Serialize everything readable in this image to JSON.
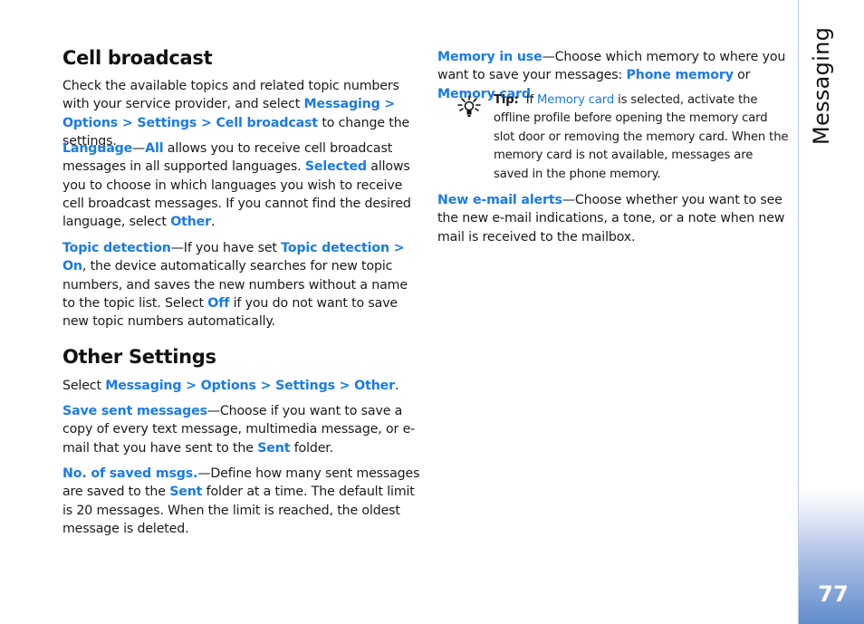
{
  "sidebar": {
    "section_label": "Messaging",
    "page_number": "77"
  },
  "left": {
    "cell_broadcast": {
      "heading": "Cell broadcast",
      "intro": {
        "t1": "Check the available topics and related topic numbers with your service provider, and select ",
        "path": "Messaging > Options > Settings > Cell broadcast",
        "t2": " to change the settings."
      },
      "language": {
        "label": "Language",
        "dash": "—",
        "all": "All",
        "t1": " allows you to receive cell broadcast messages in all supported languages. ",
        "selected": "Selected",
        "t2": " allows you to choose in which languages you wish to receive cell broadcast messages. If you cannot find the desired language, select ",
        "other": "Other",
        "t3": "."
      },
      "topic_detection": {
        "label": "Topic detection",
        "t1": "—If you have set ",
        "path": "Topic detection > On",
        "t2": ", the device automatically searches for new topic numbers, and saves the new numbers without a name to the topic list. Select ",
        "off": "Off",
        "t3": " if you do not want to save new topic numbers automatically."
      }
    },
    "other_settings": {
      "heading": "Other Settings",
      "intro": {
        "t1": "Select ",
        "path": "Messaging > Options > Settings > Other",
        "t2": "."
      },
      "save_sent": {
        "label": "Save sent messages",
        "t1": "—Choose if you want to save a copy of every text message, multimedia message, or e-mail that you have sent to the ",
        "sent": "Sent",
        "t2": " folder."
      },
      "saved_msgs": {
        "label": "No. of saved msgs.",
        "t1": "—Define how many sent messages are saved to the ",
        "sent": "Sent",
        "t2": " folder at a time. The default limit is 20 messages. When the limit is reached, the oldest message is deleted."
      }
    }
  },
  "right": {
    "memory_in_use": {
      "label": "Memory in use",
      "t1": "—Choose which memory to where you want to save your messages: ",
      "phone": "Phone memory",
      "t2": " or ",
      "card": "Memory card",
      "t3": "."
    },
    "tip": {
      "icon": "lightbulb-icon",
      "label": "Tip:",
      "t1": "  If ",
      "card": "Memory card",
      "t2": " is selected, activate the offline profile before opening the memory card slot door or removing the memory card. When the memory card is not available, messages are saved in the phone memory."
    },
    "email_alerts": {
      "label": "New e-mail alerts",
      "t1": "—Choose whether you want to see the new e-mail indications, a tone, or a note when new mail is received to the mailbox."
    }
  },
  "colors": {
    "link": "#1a7be6",
    "text": "#1a1a1a",
    "sidebar_gradient_end": "#5f8ccd"
  }
}
